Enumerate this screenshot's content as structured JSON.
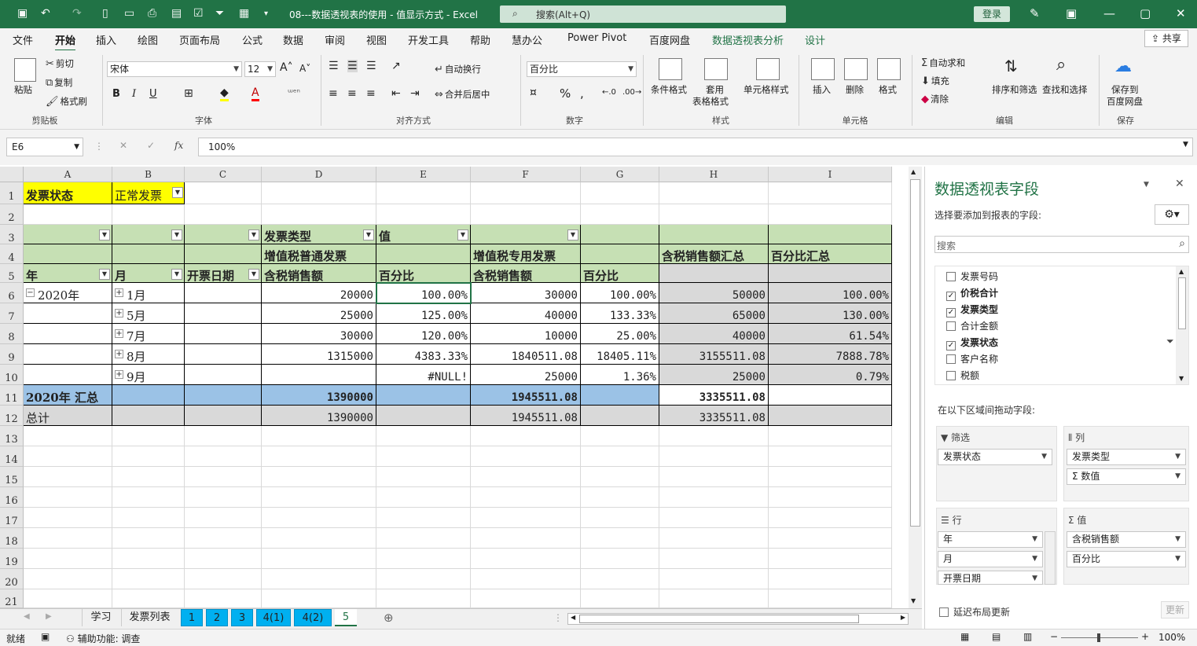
{
  "window": {
    "title": "08---数据透视表的使用 - 值显示方式  -  Excel",
    "search_placeholder": "搜索(Alt+Q)",
    "login": "登录"
  },
  "menu": {
    "tabs": [
      "文件",
      "开始",
      "插入",
      "绘图",
      "页面布局",
      "公式",
      "数据",
      "审阅",
      "视图",
      "开发工具",
      "帮助",
      "慧办公",
      "Power Pivot",
      "百度网盘",
      "数据透视表分析",
      "设计"
    ],
    "share": "共享"
  },
  "ribbon": {
    "clipboard": {
      "paste": "粘贴",
      "cut": "剪切",
      "copy": "复制",
      "format_painter": "格式刷",
      "label": "剪贴板"
    },
    "font": {
      "name": "宋体",
      "size": "12",
      "bold": "B",
      "italic": "I",
      "underline": "U",
      "label": "字体"
    },
    "align": {
      "wrap": "自动换行",
      "merge": "合并后居中",
      "label": "对齐方式"
    },
    "number": {
      "format": "百分比",
      "label": "数字"
    },
    "styles": {
      "cond": "条件格式",
      "table_fmt_1": "套用",
      "table_fmt_2": "表格格式",
      "cell_style": "单元格样式",
      "label": "样式"
    },
    "cells": {
      "insert": "插入",
      "delete": "删除",
      "format": "格式",
      "label": "单元格"
    },
    "edit": {
      "autosum": "自动求和",
      "fill": "填充",
      "clear": "清除",
      "sort": "排序和筛选",
      "find": "查找和选择",
      "label": "编辑"
    },
    "save": {
      "line1": "保存到",
      "line2": "百度网盘",
      "label": "保存"
    }
  },
  "formula_bar": {
    "name_box": "E6",
    "formula": "100%"
  },
  "grid": {
    "columns": [
      "A",
      "B",
      "C",
      "D",
      "E",
      "F",
      "G",
      "H",
      "I"
    ],
    "rows": [
      "1",
      "2",
      "3",
      "4",
      "5",
      "6",
      "7",
      "8",
      "9",
      "10",
      "11",
      "12",
      "13",
      "14",
      "15",
      "16",
      "17",
      "18",
      "19",
      "20",
      "21"
    ],
    "filter": {
      "label": "发票状态",
      "value": "正常发票"
    },
    "r3": {
      "d": "发票类型",
      "e": "值"
    },
    "r4": {
      "d": "增值税普通发票",
      "f": "增值税专用发票",
      "h": "含税销售额汇总",
      "i": "百分比汇总"
    },
    "r5": {
      "a": "年",
      "b": "月",
      "c": "开票日期",
      "d": "含税销售额",
      "e": "百分比",
      "f": "含税销售额",
      "g": "百分比"
    },
    "data": [
      {
        "a": "2020年",
        "b": "1月",
        "d": "20000",
        "e": "100.00%",
        "f": "30000",
        "g": "100.00%",
        "h": "50000",
        "i": "100.00%"
      },
      {
        "a": "",
        "b": "5月",
        "d": "25000",
        "e": "125.00%",
        "f": "40000",
        "g": "133.33%",
        "h": "65000",
        "i": "130.00%"
      },
      {
        "a": "",
        "b": "7月",
        "d": "30000",
        "e": "120.00%",
        "f": "10000",
        "g": "25.00%",
        "h": "40000",
        "i": "61.54%"
      },
      {
        "a": "",
        "b": "8月",
        "d": "1315000",
        "e": "4383.33%",
        "f": "1840511.08",
        "g": "18405.11%",
        "h": "3155511.08",
        "i": "7888.78%"
      },
      {
        "a": "",
        "b": "9月",
        "d": "",
        "e": "#NULL!",
        "f": "25000",
        "g": "1.36%",
        "h": "25000",
        "i": "0.79%"
      }
    ],
    "subtotal": {
      "a": "2020年 汇总",
      "d": "1390000",
      "f": "1945511.08",
      "h": "3335511.08"
    },
    "total": {
      "a": "总计",
      "d": "1390000",
      "f": "1945511.08",
      "h": "3335511.08"
    }
  },
  "sheets": [
    "学习",
    "发票列表",
    "1",
    "2",
    "3",
    "4(1)",
    "4(2)",
    "5"
  ],
  "status": {
    "ready": "就绪",
    "accessibility": "辅助功能: 调查",
    "zoom": "100%"
  },
  "pane": {
    "title": "数据透视表字段",
    "choose": "选择要添加到报表的字段:",
    "search_placeholder": "搜索",
    "fields": [
      {
        "name": "发票号码",
        "checked": false
      },
      {
        "name": "价税合计",
        "checked": true
      },
      {
        "name": "发票类型",
        "checked": true
      },
      {
        "name": "合计金额",
        "checked": false
      },
      {
        "name": "发票状态",
        "checked": true
      },
      {
        "name": "客户名称",
        "checked": false
      },
      {
        "name": "税额",
        "checked": false
      }
    ],
    "drag_hint": "在以下区域间拖动字段:",
    "filter_label": "筛选",
    "columns_label": "列",
    "rows_label": "行",
    "values_label": "值",
    "filter_items": [
      "发票状态"
    ],
    "column_items": [
      "发票类型",
      "Σ 数值"
    ],
    "row_items": [
      "年",
      "月",
      "开票日期"
    ],
    "value_items": [
      "含税销售额",
      "百分比"
    ],
    "defer": "延迟布局更新",
    "update": "更新"
  }
}
